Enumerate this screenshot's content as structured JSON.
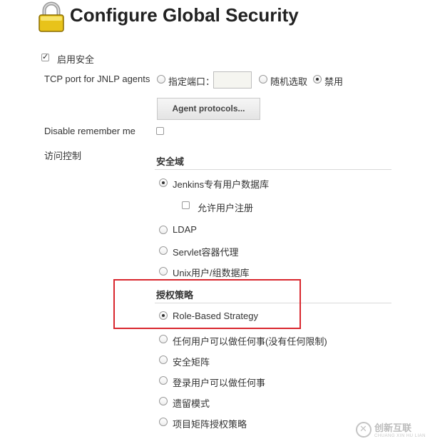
{
  "page": {
    "title": "Configure Global Security",
    "icon": "lock-icon"
  },
  "enable_security": {
    "label": "启用安全",
    "checked": true
  },
  "jnlp": {
    "label": "TCP port for JNLP agents",
    "options": [
      {
        "label": "指定端口：",
        "selected": false
      },
      {
        "label": "随机选取",
        "selected": false
      },
      {
        "label": "禁用",
        "selected": true
      }
    ],
    "port_value": "",
    "agent_protocols_button": "Agent protocols..."
  },
  "remember_me": {
    "label": "Disable remember me",
    "checked": false
  },
  "access_control": {
    "label": "访问控制",
    "security_realm": {
      "heading": "安全域",
      "options": [
        {
          "label": "Jenkins专有用户数据库",
          "selected": true
        },
        {
          "label": "LDAP",
          "selected": false
        },
        {
          "label": "Servlet容器代理",
          "selected": false
        },
        {
          "label": "Unix用户/组数据库",
          "selected": false
        }
      ],
      "allow_signup": {
        "label": "允许用户注册",
        "checked": false
      }
    },
    "authorization": {
      "heading": "授权策略",
      "options": [
        {
          "label": "Role-Based Strategy",
          "selected": true
        },
        {
          "label": "任何用户可以做任何事(没有任何限制)",
          "selected": false
        },
        {
          "label": "安全矩阵",
          "selected": false
        },
        {
          "label": "登录用户可以做任何事",
          "selected": false
        },
        {
          "label": "遗留模式",
          "selected": false
        },
        {
          "label": "项目矩阵授权策略",
          "selected": false
        }
      ]
    }
  },
  "watermark": {
    "text": "创新互联",
    "sub": "CHUANG XIN HU LIAN"
  },
  "colors": {
    "highlight_box": "#d9272e"
  }
}
